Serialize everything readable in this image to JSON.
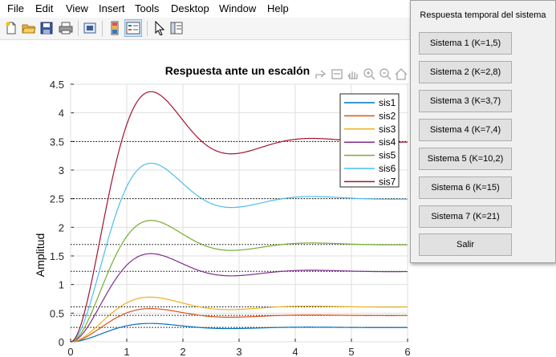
{
  "menubar": [
    "File",
    "Edit",
    "View",
    "Insert",
    "Tools",
    "Desktop",
    "Window",
    "Help"
  ],
  "toolbar_icons": [
    "new-file-icon",
    "open-folder-icon",
    "save-icon",
    "print-icon",
    "print-preview-icon",
    "colorbar-icon",
    "legend-icon",
    "pointer-icon",
    "property-editor-icon"
  ],
  "axes_toolbar_icons": [
    "export-icon",
    "brush-icon",
    "pan-icon",
    "zoom-in-icon",
    "zoom-out-icon",
    "home-icon"
  ],
  "panel": {
    "title": "Respuesta temporal del sistema",
    "buttons": [
      "Sistema 1 (K=1,5)",
      "Sistema 2 (K=2,8)",
      "Sistema 3 (K=3,7)",
      "Sistema 4 (K=7,4)",
      "Sistema 5 (K=10,2)",
      "Sistema 6 (K=15)",
      "Sistema 7 (K=21)",
      "Salir"
    ]
  },
  "chart_data": {
    "type": "line",
    "title": "Respuesta ante un escalón",
    "xlabel": "",
    "ylabel": "Amplitud",
    "xlim": [
      0,
      6
    ],
    "ylim": [
      0,
      4.5
    ],
    "x_ticks": [
      "0",
      "1",
      "2",
      "3",
      "4",
      "5",
      "6"
    ],
    "y_ticks": [
      "0",
      "0.5",
      "1",
      "1.5",
      "2",
      "2.5",
      "3",
      "3.5",
      "4",
      "4.5"
    ],
    "grid": true,
    "legend_position": "top-right",
    "series": [
      {
        "name": "sis1",
        "color": "#0072bd",
        "final": 0.25,
        "peak": 0.32
      },
      {
        "name": "sis2",
        "color": "#d95319",
        "final": 0.46,
        "peak": 0.58
      },
      {
        "name": "sis3",
        "color": "#edb120",
        "final": 0.61,
        "peak": 0.78
      },
      {
        "name": "sis4",
        "color": "#7e2f8e",
        "final": 1.23,
        "peak": 1.54
      },
      {
        "name": "sis5",
        "color": "#77ac30",
        "final": 1.7,
        "peak": 2.12
      },
      {
        "name": "sis6",
        "color": "#4dbeee",
        "final": 2.5,
        "peak": 3.12
      },
      {
        "name": "sis7",
        "color": "#a2142f",
        "final": 3.5,
        "peak": 4.37
      }
    ]
  }
}
